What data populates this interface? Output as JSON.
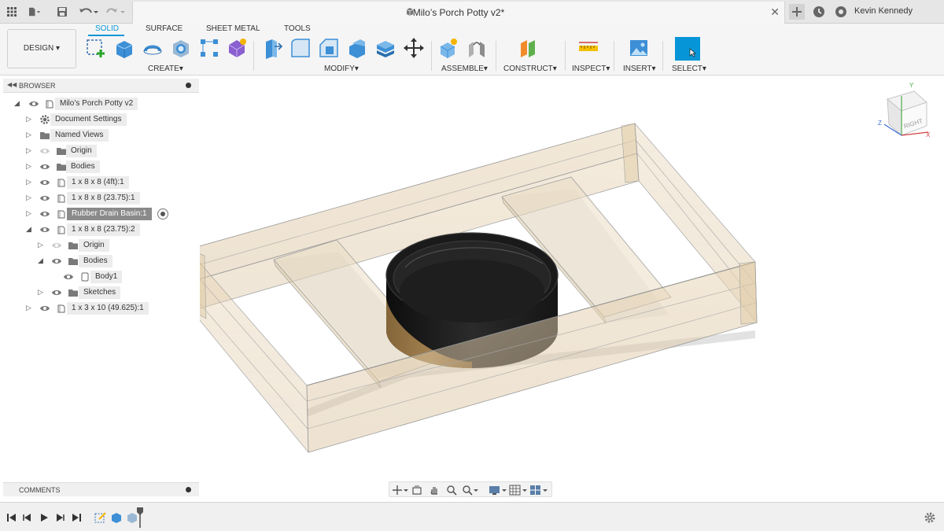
{
  "window": {
    "title": "Milo’s Porch Potty v2*",
    "user": "Kevin Kennedy"
  },
  "toolbar": {
    "workspace": "DESIGN",
    "tabs": [
      "SOLID",
      "SURFACE",
      "SHEET METAL",
      "TOOLS"
    ],
    "active_tab": "SOLID",
    "groups": {
      "create": "CREATE",
      "modify": "MODIFY",
      "assemble": "ASSEMBLE",
      "construct": "CONSTRUCT",
      "inspect": "INSPECT",
      "insert": "INSERT",
      "select": "SELECT"
    },
    "accent_color": "#0696d7"
  },
  "browser": {
    "header": "BROWSER",
    "items": [
      {
        "label": "Milo’s Porch Potty v2"
      },
      {
        "label": "Document Settings"
      },
      {
        "label": "Named Views"
      },
      {
        "label": "Origin"
      },
      {
        "label": "Bodies"
      },
      {
        "label": "1 x 8 x 8 (4ft):1"
      },
      {
        "label": "1 x 8 x 8 (23.75):1"
      },
      {
        "label": "Rubber Drain Basin:1"
      },
      {
        "label": "1 x 8 x 8 (23.75):2"
      },
      {
        "label": "Origin"
      },
      {
        "label": "Bodies"
      },
      {
        "label": "Body1"
      },
      {
        "label": "Sketches"
      },
      {
        "label": "1 x 3 x 10 (49.625):1"
      }
    ]
  },
  "comments": {
    "header": "COMMENTS"
  },
  "viewcube": {
    "face": "RIGHT",
    "axes": {
      "y": "Y",
      "z": "Z",
      "x": "X"
    }
  }
}
